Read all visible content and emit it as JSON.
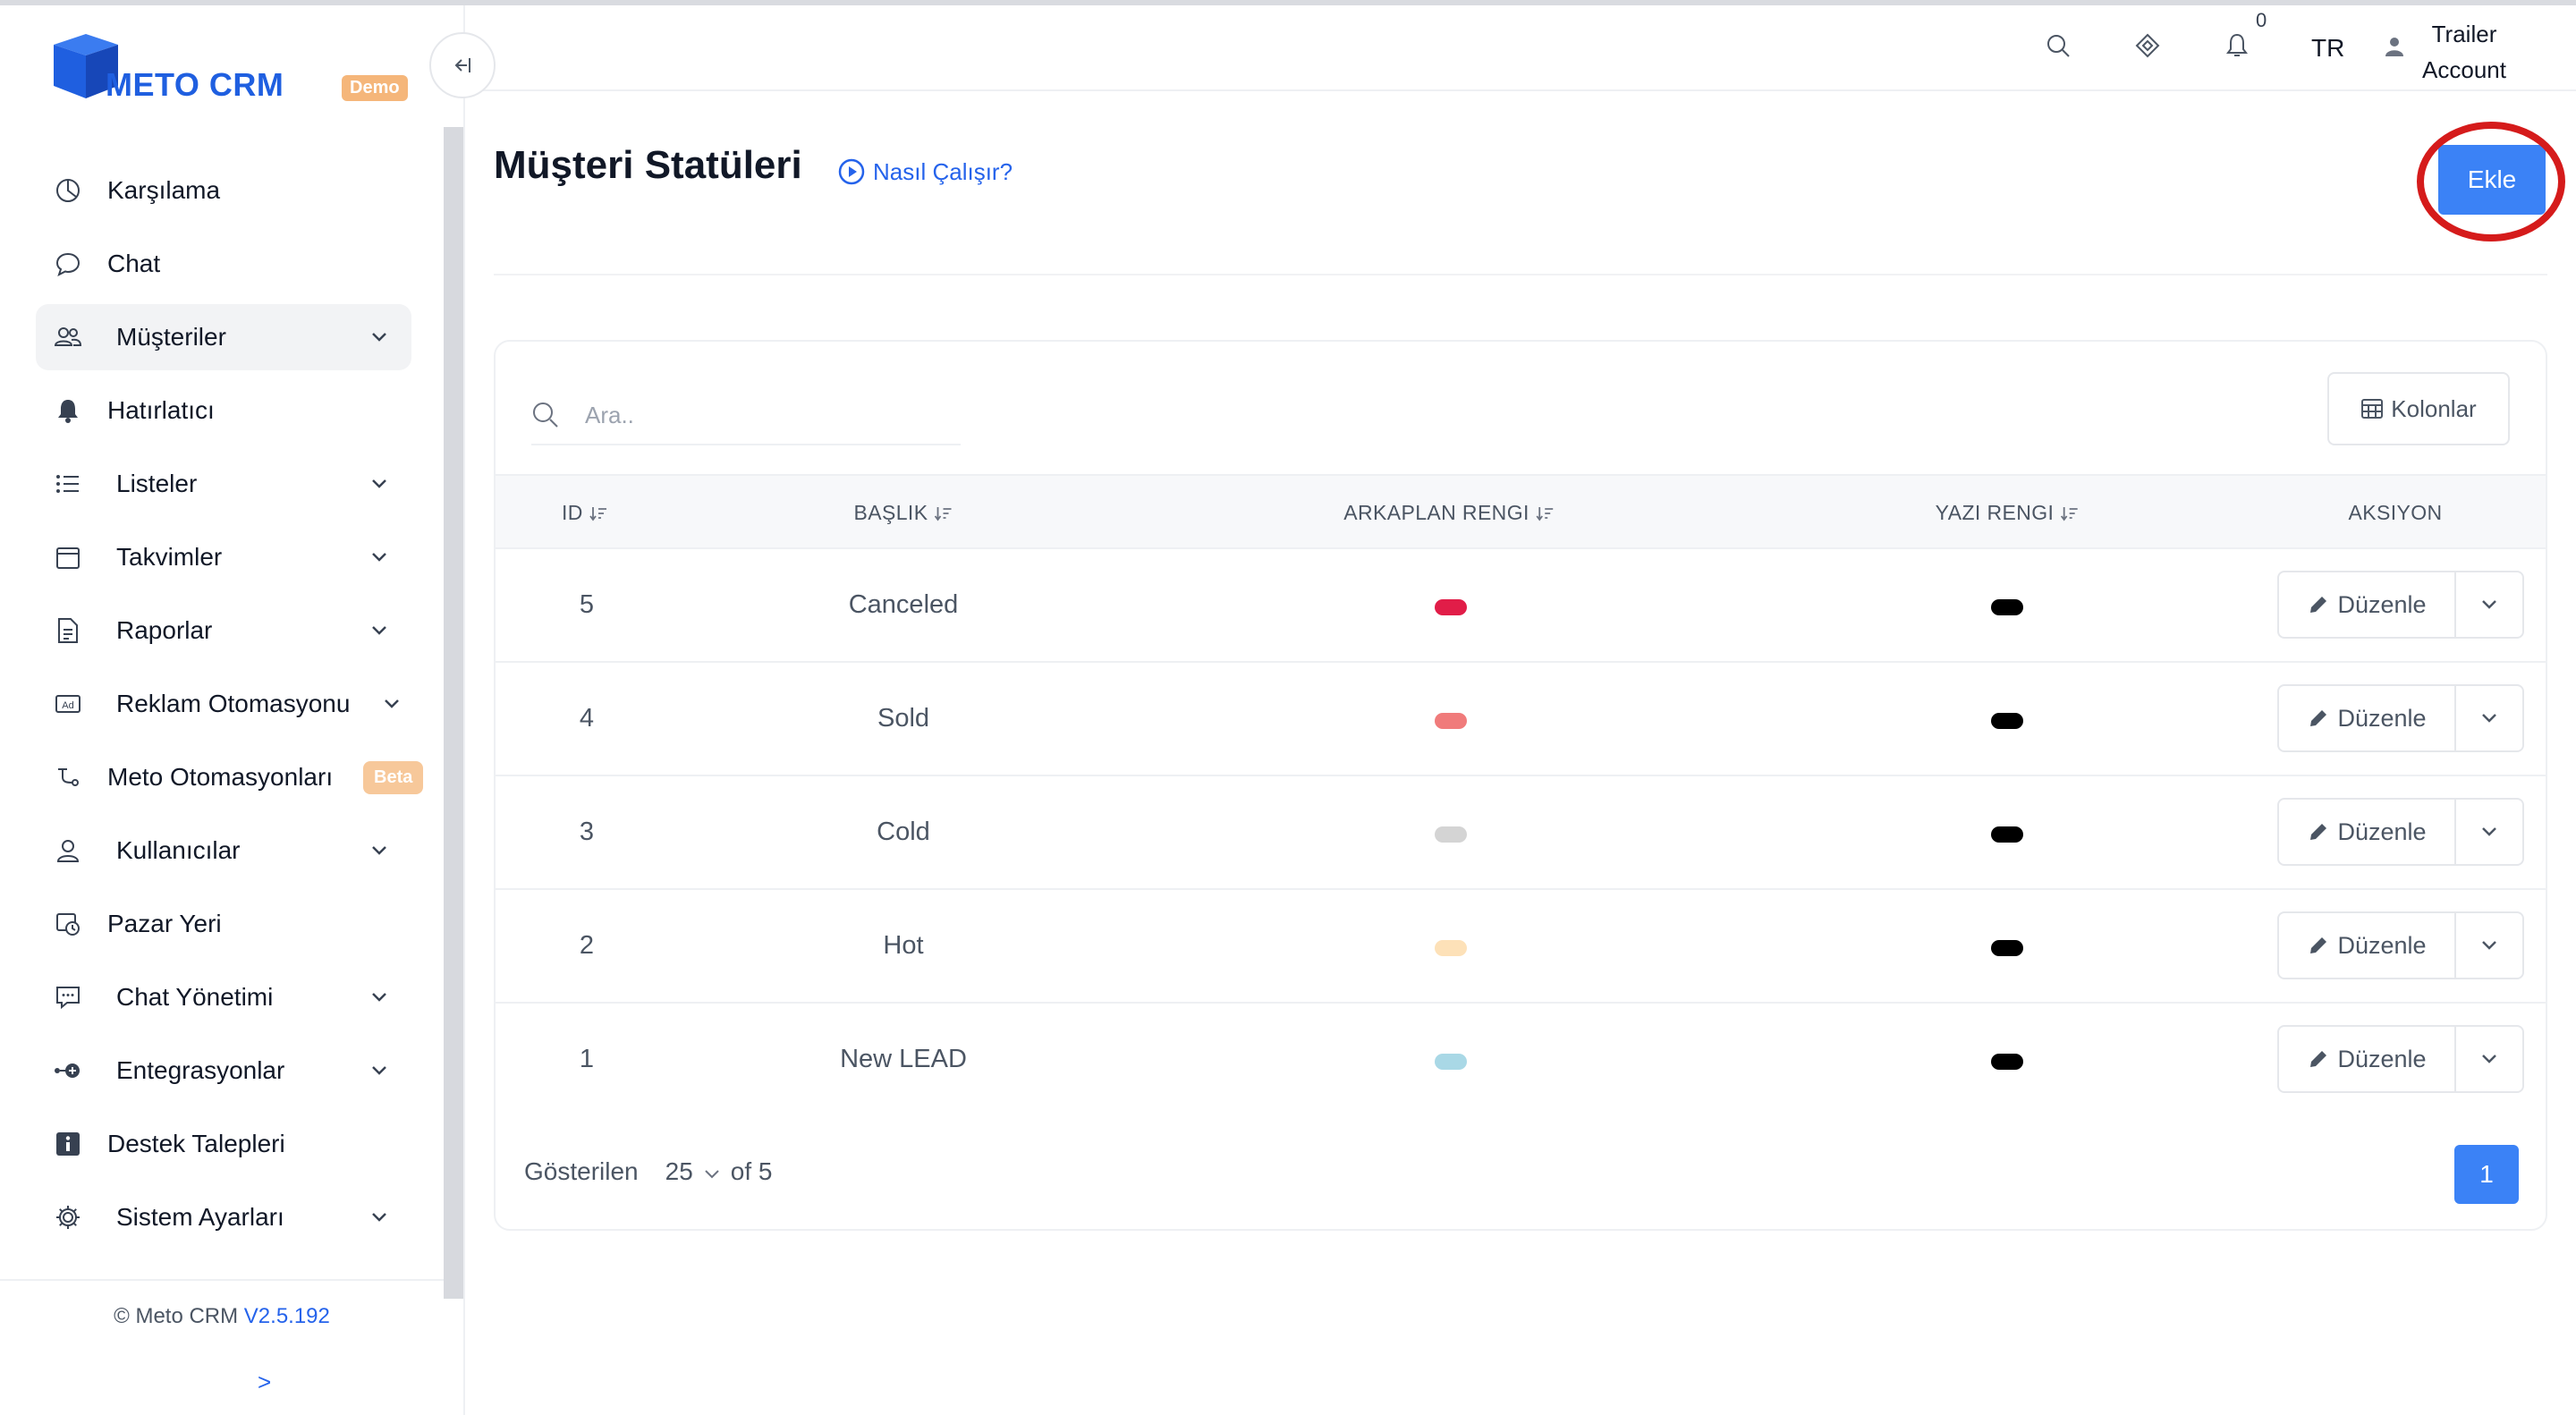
{
  "brand": {
    "name": "METO CRM",
    "badge": "Demo"
  },
  "sidebar": {
    "items": [
      {
        "label": "Karşılama",
        "icon": "dashboard-icon",
        "has_submenu": false
      },
      {
        "label": "Chat",
        "icon": "chat-bubble-icon",
        "has_submenu": false
      },
      {
        "label": "Müşteriler",
        "icon": "users-icon",
        "has_submenu": true,
        "active": true
      },
      {
        "label": "Hatırlatıcı",
        "icon": "bell-icon",
        "has_submenu": false
      },
      {
        "label": "Listeler",
        "icon": "list-icon",
        "has_submenu": true
      },
      {
        "label": "Takvimler",
        "icon": "calendar-icon",
        "has_submenu": true
      },
      {
        "label": "Raporlar",
        "icon": "report-icon",
        "has_submenu": true
      },
      {
        "label": "Reklam Otomasyonu",
        "icon": "ad-icon",
        "has_submenu": true
      },
      {
        "label": "Meto Otomasyonları",
        "icon": "automation-icon",
        "has_submenu": false,
        "badge": "Beta"
      },
      {
        "label": "Kullanıcılar",
        "icon": "user-icon",
        "has_submenu": true
      },
      {
        "label": "Pazar Yeri",
        "icon": "marketplace-icon",
        "has_submenu": false
      },
      {
        "label": "Chat Yönetimi",
        "icon": "chat-manage-icon",
        "has_submenu": true
      },
      {
        "label": "Entegrasyonlar",
        "icon": "integration-icon",
        "has_submenu": true
      },
      {
        "label": "Destek Talepleri",
        "icon": "info-icon",
        "has_submenu": false
      },
      {
        "label": "Sistem Ayarları",
        "icon": "gear-icon",
        "has_submenu": true
      }
    ],
    "footer": {
      "copyright": "© Meto CRM",
      "version": "V2.5.192",
      "expand": ">"
    }
  },
  "header": {
    "notifications_count": "0",
    "language": "TR",
    "user_line1": "Trailer",
    "user_line2": "Account"
  },
  "page": {
    "title": "Müşteri Statüleri",
    "help_link": "Nasıl Çalışır?",
    "add_button": "Ekle"
  },
  "table": {
    "search_placeholder": "Ara..",
    "columns_button": "Kolonlar",
    "headers": {
      "id": "ID",
      "title": "BAŞLIK",
      "bg_color": "ARKAPLAN RENGI",
      "text_color": "YAZI RENGI",
      "action": "AKSIYON"
    },
    "edit_label": "Düzenle",
    "rows": [
      {
        "id": "5",
        "title": "Canceled",
        "bg_color": "#e11d48",
        "text_color": "#000000"
      },
      {
        "id": "4",
        "title": "Sold",
        "bg_color": "#f07b7b",
        "text_color": "#000000"
      },
      {
        "id": "3",
        "title": "Cold",
        "bg_color": "#d4d4d4",
        "text_color": "#000000"
      },
      {
        "id": "2",
        "title": "Hot",
        "bg_color": "#fde1b8",
        "text_color": "#000000"
      },
      {
        "id": "1",
        "title": "New LEAD",
        "bg_color": "#a9d8e6",
        "text_color": "#000000"
      }
    ],
    "pagination": {
      "shown_label": "Gösterilen",
      "page_size": "25",
      "of_label": "of 5",
      "current_page": "1"
    }
  },
  "colors": {
    "accent": "#3b82f6",
    "brand": "#1f5fe0",
    "highlight": "#d51b1b"
  }
}
